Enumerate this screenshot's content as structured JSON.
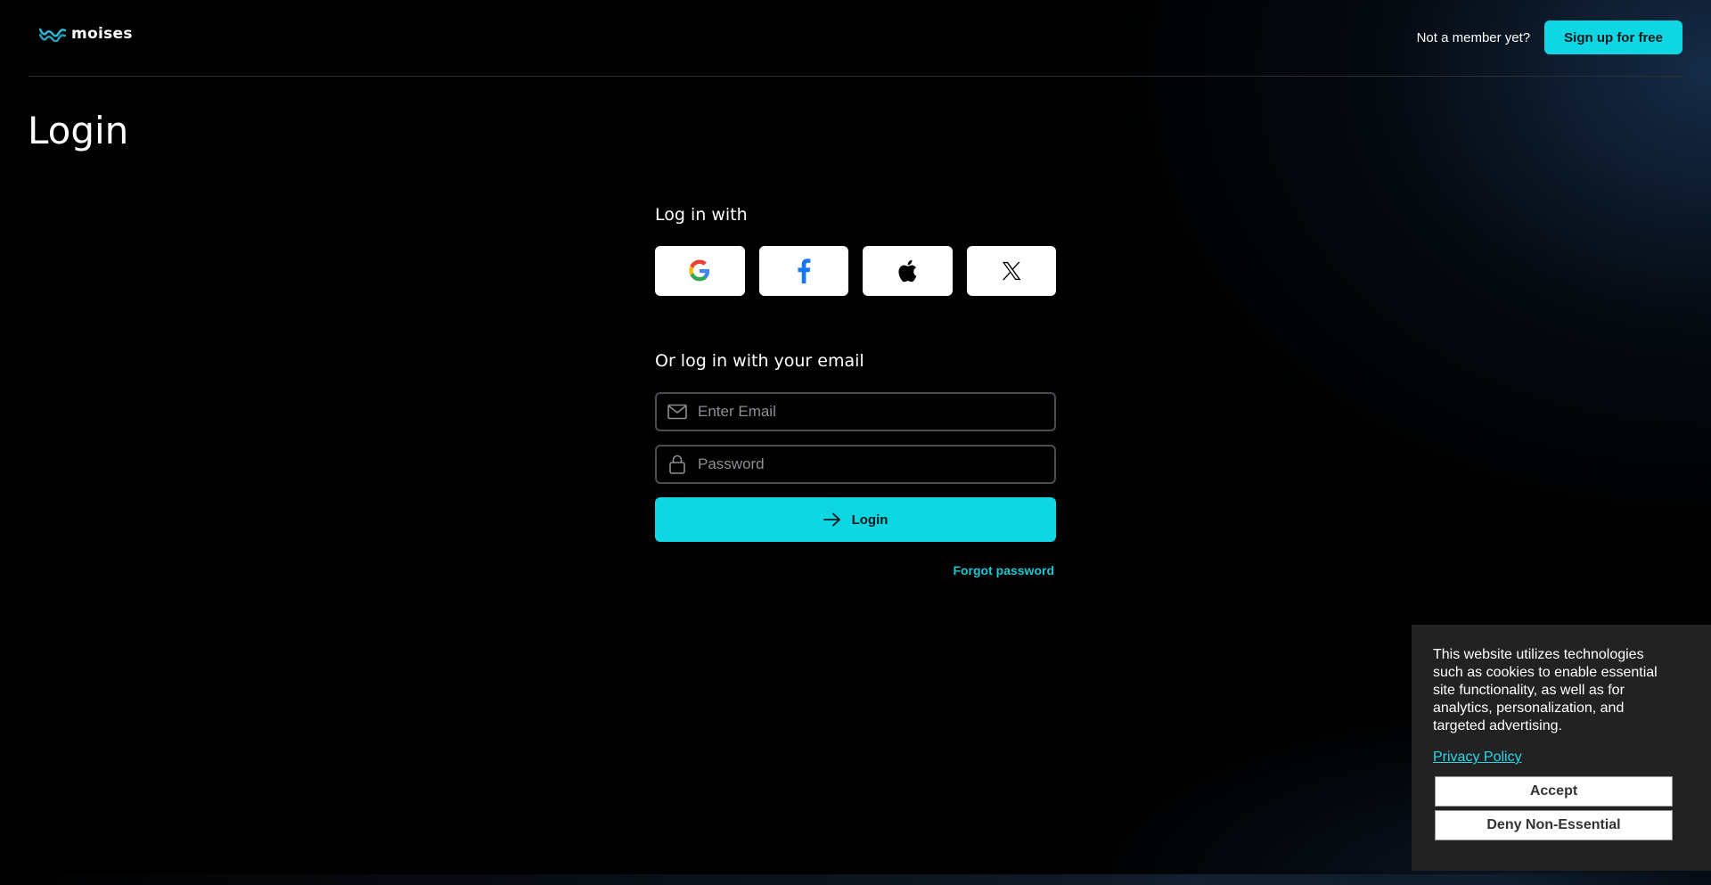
{
  "header": {
    "logo_text": "moises",
    "not_member": "Not a member yet?",
    "signup_label": "Sign up for free"
  },
  "page": {
    "title": "Login"
  },
  "social": {
    "label": "Log in with",
    "providers": [
      "google-icon",
      "facebook-icon",
      "apple-icon",
      "x-icon"
    ]
  },
  "email_login": {
    "label": "Or log in with your email",
    "email_placeholder": "Enter Email",
    "password_placeholder": "Password",
    "login_label": "Login",
    "forgot_label": "Forgot password"
  },
  "cookie_banner": {
    "text": "This website utilizes technologies such as cookies to enable essential site functionality, as well as for analytics, personalization, and targeted advertising.",
    "privacy_label": "Privacy Policy",
    "accept_label": "Accept",
    "deny_label": "Deny Non-Essential"
  },
  "colors": {
    "accent": "#0fd6e3",
    "link": "#18c6d4",
    "background": "#000000",
    "cookie_bg": "#222222"
  }
}
